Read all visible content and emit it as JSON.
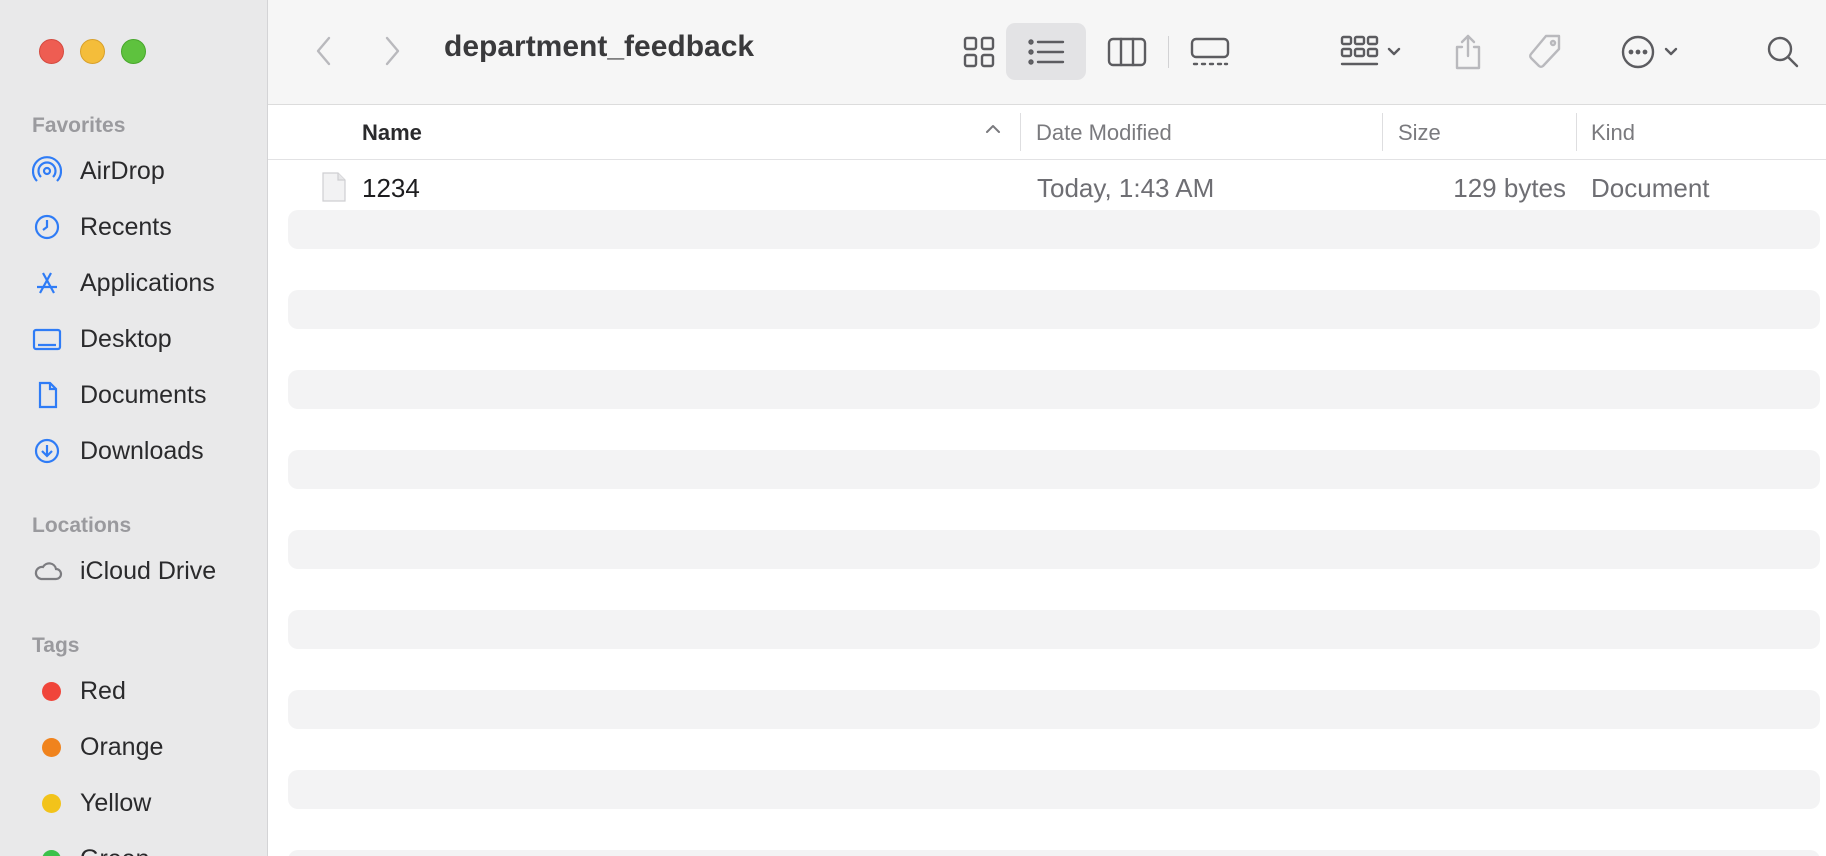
{
  "window": {
    "title": "department_feedback"
  },
  "sidebar": {
    "favorites_title": "Favorites",
    "favorites": [
      {
        "label": "AirDrop",
        "icon": "airdrop-icon"
      },
      {
        "label": "Recents",
        "icon": "clock-icon"
      },
      {
        "label": "Applications",
        "icon": "applications-icon"
      },
      {
        "label": "Desktop",
        "icon": "desktop-icon"
      },
      {
        "label": "Documents",
        "icon": "document-icon"
      },
      {
        "label": "Downloads",
        "icon": "download-icon"
      }
    ],
    "locations_title": "Locations",
    "locations": [
      {
        "label": "iCloud Drive",
        "icon": "cloud-icon"
      }
    ],
    "tags_title": "Tags",
    "tags": [
      {
        "label": "Red",
        "color": "#f0453a"
      },
      {
        "label": "Orange",
        "color": "#f0831d"
      },
      {
        "label": "Yellow",
        "color": "#f2c31a"
      },
      {
        "label": "Green",
        "color": "#3cc14a"
      }
    ]
  },
  "list": {
    "columns": {
      "name": "Name",
      "date_modified": "Date Modified",
      "size": "Size",
      "kind": "Kind"
    },
    "files": [
      {
        "name": "1234",
        "date_modified": "Today, 1:43 AM",
        "size": "129 bytes",
        "kind": "Document"
      }
    ]
  },
  "colors": {
    "accent": "#2f7cf6",
    "sidebar_bg": "#e9e9ea"
  }
}
